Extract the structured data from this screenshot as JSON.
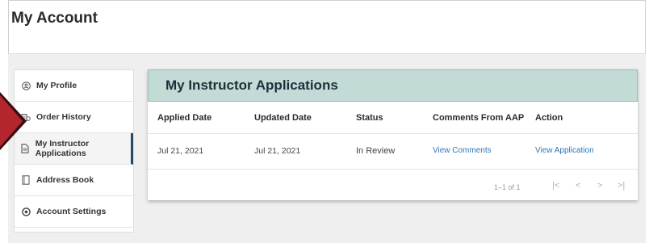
{
  "page": {
    "title": "My Account"
  },
  "sidebar": {
    "items": [
      {
        "label": "My Profile",
        "icon": "profile-icon",
        "active": false
      },
      {
        "label": "Order History",
        "icon": "order-history-icon",
        "active": false
      },
      {
        "label": "My Instructor Applications",
        "icon": "document-icon",
        "active": true
      },
      {
        "label": "Address Book",
        "icon": "address-book-icon",
        "active": false
      },
      {
        "label": "Account Settings",
        "icon": "settings-icon",
        "active": false
      }
    ]
  },
  "card": {
    "title": "My Instructor Applications",
    "columns": [
      "Applied Date",
      "Updated Date",
      "Status",
      "Comments From AAP",
      "Action"
    ],
    "rows": [
      {
        "applied": "Jul 21, 2021",
        "updated": "Jul 21, 2021",
        "status": "In Review",
        "comments": "View Comments",
        "action": "View Application"
      }
    ],
    "pagination": {
      "text": "1–1 of 1",
      "first": "|<",
      "prev": "<",
      "next": ">",
      "last": ">|"
    }
  },
  "colors": {
    "header_bg": "#c2dbd7",
    "link": "#2f77b5",
    "arrow": "#b3262e",
    "active_border": "#234a67"
  }
}
